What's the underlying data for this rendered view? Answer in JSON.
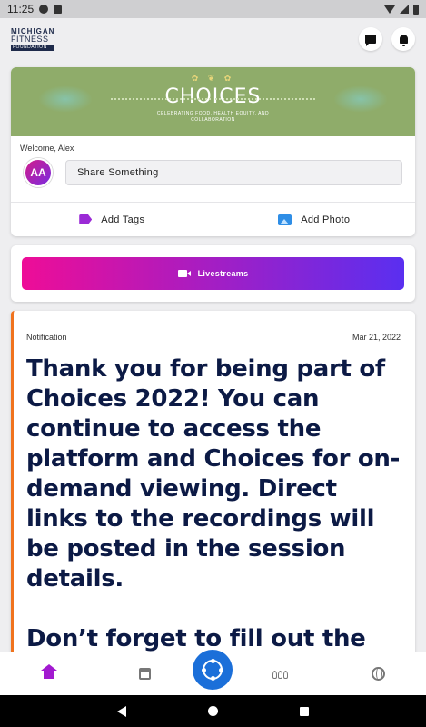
{
  "status_bar": {
    "time": "11:25"
  },
  "header": {
    "logo_lines": [
      "MICHIGAN",
      "FITNESS",
      "FOUNDATION"
    ],
    "icons": [
      "chat-icon",
      "notification-bell-icon"
    ]
  },
  "post": {
    "banner": {
      "title": "CHOICES",
      "subtitle": "CELEBRATING FOOD, HEALTH EQUITY, AND COLLABORATION"
    },
    "welcome": "Welcome, Alex",
    "avatar_initials": "AA",
    "share_placeholder": "Share Something",
    "actions": [
      {
        "label": "Add Tags",
        "icon": "tag-icon"
      },
      {
        "label": "Add Photo",
        "icon": "photo-icon"
      }
    ]
  },
  "livestreams": {
    "label": "Livestreams",
    "icon": "video-camera-icon"
  },
  "notification": {
    "type": "Notification",
    "date": "Mar 21, 2022",
    "paragraphs": [
      "Thank you for being part of Choices 2022! You can continue to access the platform and Choices for on-demand viewing. Direct links to the recordings will be posted in the session details.",
      "Don’t forget to fill out the session feedback surveys for"
    ]
  },
  "bottom_nav": {
    "items": [
      "home-icon",
      "calendar-icon",
      "hub-icon",
      "people-icon",
      "globe-icon"
    ],
    "active": "home-icon"
  },
  "colors": {
    "accent_pink": "#ee0d97",
    "accent_purple": "#5a2ff0",
    "brand_navy": "#0c1a45",
    "hub_blue": "#1b6fd9",
    "notification_border": "#f0731e"
  }
}
